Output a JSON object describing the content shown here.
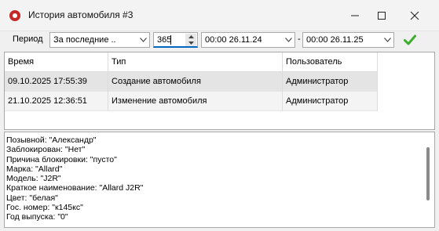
{
  "window": {
    "title": "История автомобиля #3"
  },
  "toolbar": {
    "period_label": "Период",
    "period_select": "За последние ..",
    "days_value": "365",
    "date_from": "00:00 26.11.24",
    "separator": "-",
    "date_to": "00:00 26.11.25"
  },
  "grid": {
    "columns": [
      "Время",
      "Тип",
      "Пользователь"
    ],
    "rows": [
      [
        "09.10.2025 17:55:39",
        "Создание автомобиля",
        "Администратор"
      ],
      [
        "21.10.2025 12:36:51",
        "Изменение автомобиля",
        "Администратор"
      ]
    ]
  },
  "details": {
    "lines": [
      "Позывной: \"Александр\"",
      "Заблокирован: \"Нет\"",
      "Причина блокировки: \"пусто\"",
      "Марка: \"Allard\"",
      "Модель: \"J2R\"",
      "Краткое наименование: \"Allard J2R\"",
      "Цвет: \"белая\"",
      "Гос. номер: \"к145кс\"",
      "Год выпуска: \"0\""
    ]
  },
  "icons": {
    "app": "app-record-icon",
    "minimize": "minimize-icon",
    "maximize": "maximize-icon",
    "close": "close-icon",
    "apply": "checkmark-icon"
  },
  "colors": {
    "apply_check": "#3cae2e",
    "app_icon": "#c62828",
    "spin_focus": "#0067c0"
  }
}
